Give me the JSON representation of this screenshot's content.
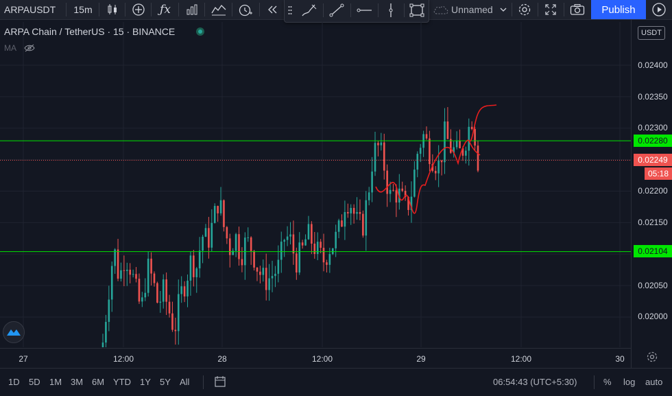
{
  "toolbar": {
    "symbol": "ARPAUSDT",
    "interval": "15m",
    "layout_name": "Unnamed",
    "publish_label": "Publish"
  },
  "legend": {
    "title": "ARPA Chain / TetherUS · 15 · BINANCE",
    "indicator": "MA"
  },
  "price_axis": {
    "currency": "USDT",
    "ticks": [
      "0.02400",
      "0.02350",
      "0.02300",
      "0.02200",
      "0.02150",
      "0.02050",
      "0.02000"
    ],
    "horizontal_line_1": "0.02280",
    "horizontal_line_2": "0.02104",
    "current_price": "0.02249",
    "countdown": "05:18"
  },
  "time_axis": {
    "ticks": [
      "27",
      "12:00",
      "28",
      "12:00",
      "29",
      "12:00",
      "30"
    ]
  },
  "bottom_bar": {
    "ranges": [
      "1D",
      "5D",
      "1M",
      "3M",
      "6M",
      "YTD",
      "1Y",
      "5Y",
      "All"
    ],
    "clock": "06:54:43 (UTC+5:30)",
    "percent_label": "%",
    "log_label": "log",
    "auto_label": "auto"
  },
  "colors": {
    "up": "#26a69a",
    "down": "#ef5350",
    "hline": "#00e600",
    "drawing": "#e91e1e",
    "accent": "#2962ff"
  },
  "chart_data": {
    "type": "candlestick",
    "symbol": "ARPAUSDT",
    "timeframe": "15",
    "ylim": [
      0.0196,
      0.0244
    ],
    "horizontal_lines": [
      0.0228,
      0.02104
    ],
    "current_price": 0.02249,
    "close_series": [
      0.0196,
      0.0204,
      0.0211,
      0.0206,
      0.021,
      0.0208,
      0.0204,
      0.0201,
      0.0208,
      0.0206,
      0.0202,
      0.0204,
      0.0201,
      0.0198,
      0.0203,
      0.0206,
      0.0209,
      0.0208,
      0.0213,
      0.0212,
      0.0215,
      0.0219,
      0.0214,
      0.0211,
      0.0213,
      0.021,
      0.0212,
      0.0211,
      0.0208,
      0.0206,
      0.0206,
      0.0207,
      0.0208,
      0.0213,
      0.0212,
      0.0209,
      0.021,
      0.0213,
      0.0212,
      0.021,
      0.0209,
      0.0211,
      0.0212,
      0.0214,
      0.0219,
      0.0218,
      0.0215,
      0.0214,
      0.0219,
      0.0226,
      0.0227,
      0.0224,
      0.0219,
      0.022,
      0.0219,
      0.0217,
      0.022,
      0.0226,
      0.0229,
      0.0227,
      0.0225,
      0.0224,
      0.0229,
      0.0227,
      0.0226,
      0.0226,
      0.0229,
      0.0232,
      0.0225
    ]
  }
}
